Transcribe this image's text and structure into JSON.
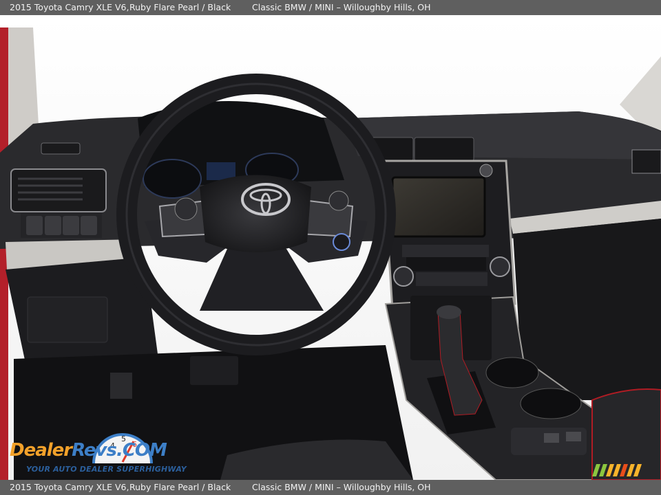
{
  "caption": {
    "vehicle": "2015 Toyota Camry XLE V6,",
    "colors": "Ruby Flare Pearl / Black",
    "dealer": "Classic BMW / MINI – Willoughby Hills, OH"
  },
  "watermark": {
    "brand_part1": "Dealer",
    "brand_part2": "Revs",
    "brand_suffix": ".COM",
    "tagline": "YOUR AUTO DEALER SUPERHIGHWAY"
  },
  "photo": {
    "subject": "steering-wheel-and-dashboard",
    "interior_color": "#1e1e20",
    "exterior_color": "#b3202a"
  },
  "colors": {
    "caption_bar": "#5f5f5f",
    "logo_orange": "#f2a12a",
    "logo_blue": "#3d7fc7"
  }
}
